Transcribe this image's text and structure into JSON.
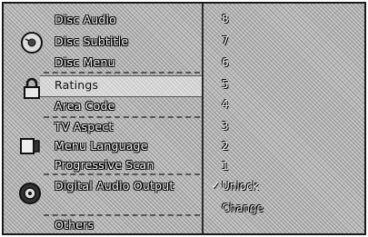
{
  "menu": {
    "items": [
      {
        "label": "Disc Audio"
      },
      {
        "label": "Disc Subtitle"
      },
      {
        "label": "Disc Menu"
      },
      {
        "label": "Ratings"
      },
      {
        "label": "Area Code"
      },
      {
        "label": "TV Aspect"
      },
      {
        "label": "Menu Language"
      },
      {
        "label": "Progressive Scan"
      },
      {
        "label": "Digital Audio Output"
      },
      {
        "label": "Others"
      }
    ],
    "selected": "Ratings"
  },
  "options": {
    "items": [
      {
        "label": "8"
      },
      {
        "label": "7"
      },
      {
        "label": "6"
      },
      {
        "label": "5"
      },
      {
        "label": "4"
      },
      {
        "label": "3"
      },
      {
        "label": "2"
      },
      {
        "label": "1"
      },
      {
        "label": "Unlock"
      },
      {
        "label": "Change"
      }
    ],
    "checked": "Unlock",
    "check_glyph": "✓"
  },
  "icons": [
    "disc-icon",
    "lock-icon",
    "tv-icon",
    "speaker-icon"
  ],
  "colors": {
    "text": "#f4f4f4",
    "selected_text": "#111111",
    "outline": "#000000"
  }
}
